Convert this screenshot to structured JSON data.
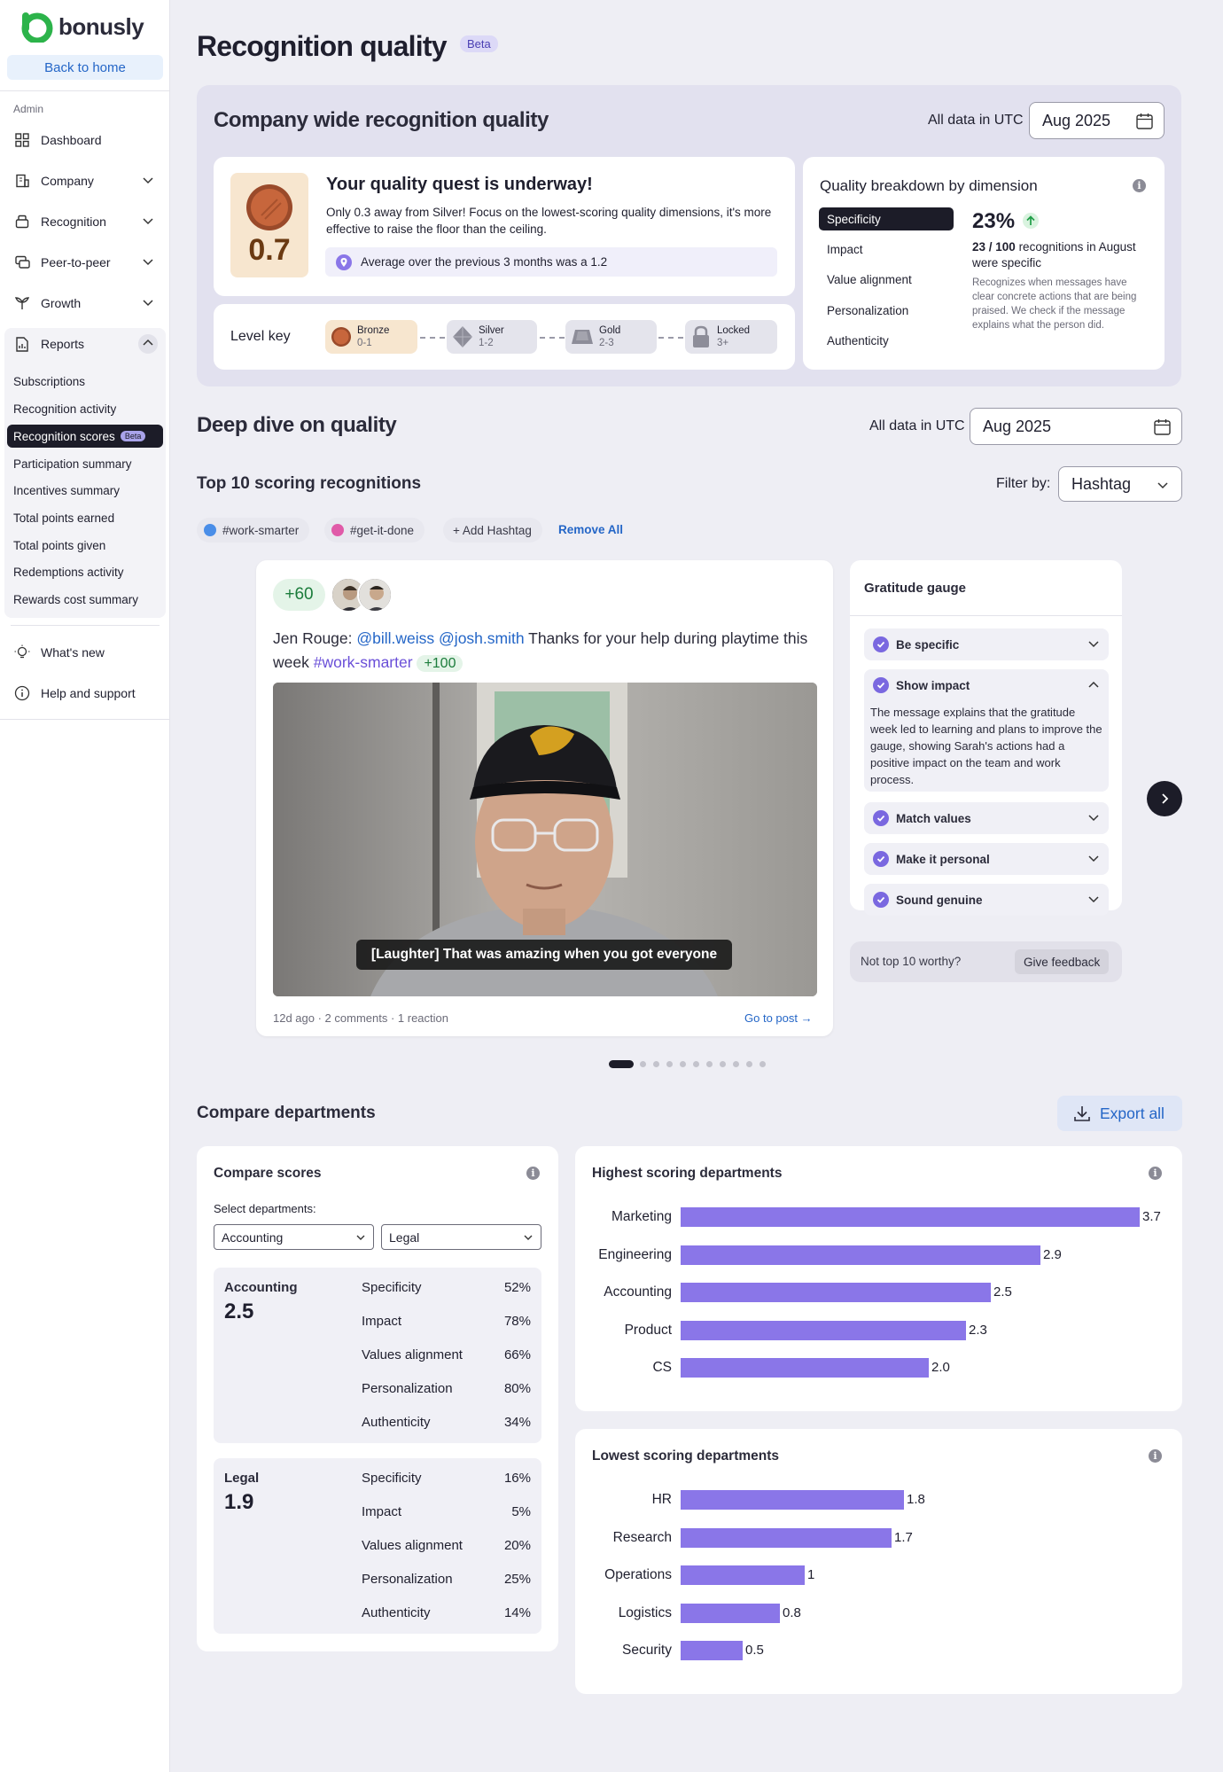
{
  "sidebar": {
    "logo": "bonusly",
    "back": "Back to home",
    "admin": "Admin",
    "nav": [
      "Dashboard",
      "Company",
      "Recognition",
      "Peer-to-peer",
      "Growth",
      "Reports"
    ],
    "reports_sub": [
      "Subscriptions",
      "Recognition activity",
      "Recognition scores",
      "Participation summary",
      "Incentives summary",
      "Total points earned",
      "Total points given",
      "Redemptions activity",
      "Rewards cost summary"
    ],
    "beta_mini": "Beta",
    "whats_new": "What's new",
    "help": "Help and support"
  },
  "page": {
    "title": "Recognition quality",
    "beta": "Beta"
  },
  "company": {
    "title": "Company wide recognition quality",
    "utc": "All data in UTC",
    "date": "Aug 2025",
    "score": "0.7",
    "quest_title": "Your quality quest is underway!",
    "quest_body": "Only 0.3 away from Silver! Focus on the lowest-scoring quality dimensions, it's more effective to raise the floor than the ceiling.",
    "avg_note": "Average over the previous 3 months was a 1.2",
    "level_key": "Level key",
    "levels": [
      {
        "name": "Bronze",
        "range": "0-1"
      },
      {
        "name": "Silver",
        "range": "1-2"
      },
      {
        "name": "Gold",
        "range": "2-3"
      },
      {
        "name": "Locked",
        "range": "3+"
      }
    ],
    "breakdown_title": "Quality breakdown by dimension",
    "dimensions": [
      "Specificity",
      "Impact",
      "Value alignment",
      "Personalization",
      "Authenticity"
    ],
    "dim_pct": "23%",
    "dim_count": "23 / 100",
    "dim_count_rest": "recognitions in August were specific",
    "dim_desc": "Recognizes when messages have clear concrete actions that are being praised. We check if the message explains what the person did."
  },
  "deep": {
    "title": "Deep dive on quality",
    "utc": "All data in UTC",
    "date": "Aug 2025",
    "top10": "Top 10 scoring recognitions",
    "filter_label": "Filter by:",
    "filter_value": "Hashtag",
    "tags": [
      "#work-smarter",
      "#get-it-done"
    ],
    "add_hashtag": "+ Add Hashtag",
    "remove_all": "Remove All",
    "post": {
      "points": "+60",
      "author": "Jen Rouge:",
      "mentions": "@bill.weiss @josh.smith",
      "text": "Thanks for your help during playtime this week",
      "hashtag": "#work-smarter",
      "bonus": "+100",
      "caption": "[Laughter] That was amazing when you got everyone",
      "meta": "12d ago · 2 comments · 1 reaction",
      "go": "Go to post →"
    },
    "gauge": {
      "title": "Gratitude gauge",
      "items": [
        "Be specific",
        "Show impact",
        "Match values",
        "Make it personal",
        "Sound genuine"
      ],
      "impact_detail": "The message explains that the gratitude week led to learning and plans to improve the gauge, showing Sarah's actions had a positive impact on the team and work process.",
      "not_worthy": "Not top 10 worthy?",
      "feedback": "Give feedback"
    }
  },
  "compare": {
    "title": "Compare departments",
    "export": "Export all",
    "scores_title": "Compare scores",
    "select_label": "Select departments:",
    "sel1": "Accounting",
    "sel2": "Legal",
    "dept_a": {
      "name": "Accounting",
      "score": "2.5",
      "rows": [
        [
          "Specificity",
          "52%"
        ],
        [
          "Impact",
          "78%"
        ],
        [
          "Values alignment",
          "66%"
        ],
        [
          "Personalization",
          "80%"
        ],
        [
          "Authenticity",
          "34%"
        ]
      ]
    },
    "dept_b": {
      "name": "Legal",
      "score": "1.9",
      "rows": [
        [
          "Specificity",
          "16%"
        ],
        [
          "Impact",
          "5%"
        ],
        [
          "Values alignment",
          "20%"
        ],
        [
          "Personalization",
          "25%"
        ],
        [
          "Authenticity",
          "14%"
        ]
      ]
    }
  },
  "chart_data": [
    {
      "type": "bar",
      "orientation": "horizontal",
      "title": "Highest scoring departments",
      "categories": [
        "Marketing",
        "Engineering",
        "Accounting",
        "Product",
        "CS"
      ],
      "values": [
        3.7,
        2.9,
        2.5,
        2.3,
        2.0
      ],
      "value_labels": [
        "3.7",
        "2.9",
        "2.5",
        "2.3",
        "2.0"
      ],
      "color": "#8a76e8"
    },
    {
      "type": "bar",
      "orientation": "horizontal",
      "title": "Lowest scoring departments",
      "categories": [
        "HR",
        "Research",
        "Operations",
        "Logistics",
        "Security"
      ],
      "values": [
        1.8,
        1.7,
        1,
        0.8,
        0.5
      ],
      "value_labels": [
        "1.8",
        "1.7",
        "1",
        "0.8",
        "0.5"
      ],
      "color": "#8a76e8"
    }
  ]
}
